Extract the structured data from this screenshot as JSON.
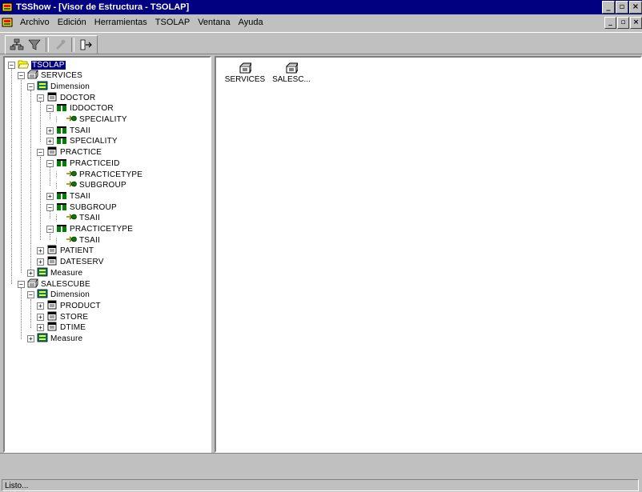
{
  "window": {
    "title": "TSShow - [Visor de Estructura - TSOLAP]",
    "controls": [
      "_",
      "̅□",
      "X"
    ]
  },
  "menu": [
    {
      "label": "Archivo"
    },
    {
      "label": "Edición"
    },
    {
      "label": "Herramientas"
    },
    {
      "label": "TSOLAP"
    },
    {
      "label": "Ventana"
    },
    {
      "label": "Ayuda"
    }
  ],
  "tree": {
    "root": "TSOLAP",
    "cube1": "SERVICES",
    "dimension": "Dimension",
    "doctor": "DOCTOR",
    "iddoctor": "IDDOCTOR",
    "speciality_key": "SPECIALITY",
    "tsaii": "TSAII",
    "speciality": "SPECIALITY",
    "practice": "PRACTICE",
    "practiceid": "PRACTICEID",
    "practicetype_key": "PRACTICETYPE",
    "subgroup_key": "SUBGROUP",
    "tsaii2": "TSAII",
    "subgroup": "SUBGROUP",
    "tsaii3": "TSAII",
    "practicetype": "PRACTICETYPE",
    "tsaii4": "TSAII",
    "patient": "PATIENT",
    "dateserv": "DATESERV",
    "measure": "Measure",
    "cube2": "SALESCUBE",
    "dimension2": "Dimension",
    "product": "PRODUCT",
    "store": "STORE",
    "dtime": "DTIME",
    "measure2": "Measure"
  },
  "content": {
    "items": [
      {
        "label": "SERVICES"
      },
      {
        "label": "SALESC..."
      }
    ]
  },
  "status": {
    "text": "Listo..."
  }
}
